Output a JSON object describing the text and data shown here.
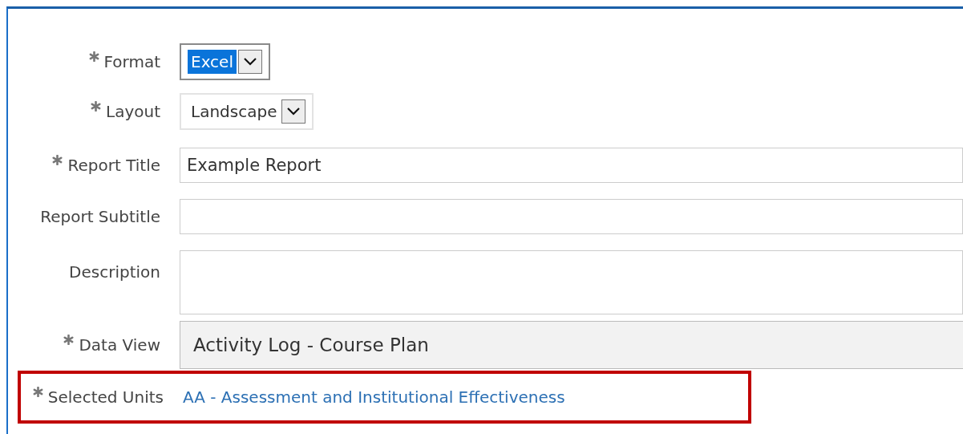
{
  "fields": [
    {
      "label": "Format",
      "required": true,
      "kind": "select",
      "value": "Excel",
      "focused": true
    },
    {
      "label": "Layout",
      "required": true,
      "kind": "select",
      "value": "Landscape",
      "focused": false
    },
    {
      "label": "Report Title",
      "required": true,
      "kind": "input",
      "value": "Example Report"
    },
    {
      "label": "Report Subtitle",
      "required": false,
      "kind": "input"
    },
    {
      "label": "Description",
      "required": false,
      "kind": "textarea"
    },
    {
      "label": "Data View",
      "required": true,
      "kind": "readonly",
      "value": "Activity Log - Course Plan"
    },
    {
      "label": "Selected Units",
      "required": true,
      "kind": "link",
      "value": "AA - Assessment and Institutional Effectiveness",
      "highlighted": true
    }
  ]
}
